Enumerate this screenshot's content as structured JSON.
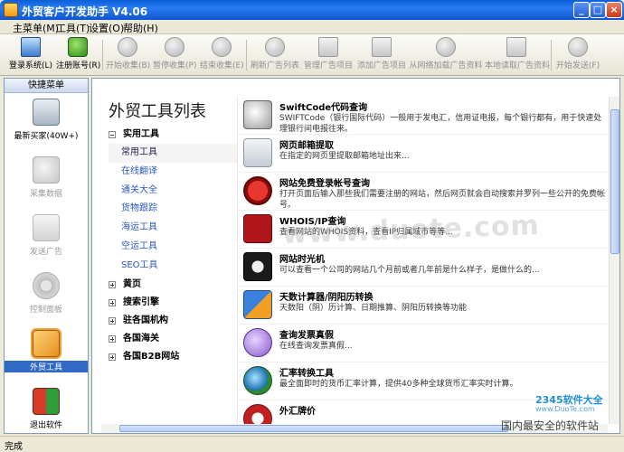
{
  "window": {
    "title": "外贸客户开发助手 V4.06"
  },
  "menu": [
    "主菜单(M)",
    "工具(T)",
    "设置(O)",
    "帮助(H)"
  ],
  "toolbar": [
    {
      "label": "登录系统(L)",
      "icon": "monitor-icon",
      "enabled": true
    },
    {
      "label": "注册账号(R)",
      "icon": "add-user-icon",
      "enabled": true
    },
    {
      "label": "开始收集(B)",
      "icon": "play-icon",
      "enabled": false
    },
    {
      "label": "暂停收集(P)",
      "icon": "pause-icon",
      "enabled": false
    },
    {
      "label": "结束收集(E)",
      "icon": "stop-icon",
      "enabled": false
    },
    {
      "label": "刷新广告列表",
      "icon": "refresh-icon",
      "enabled": false
    },
    {
      "label": "管理广告项目",
      "icon": "list-icon",
      "enabled": false
    },
    {
      "label": "添加广告项目",
      "icon": "add-doc-icon",
      "enabled": false
    },
    {
      "label": "从网络加载广告资料",
      "icon": "network-download-icon",
      "enabled": false
    },
    {
      "label": "本地读取广告资料",
      "icon": "open-book-icon",
      "enabled": false
    },
    {
      "label": "开始发送(F)",
      "icon": "send-icon",
      "enabled": false
    }
  ],
  "sidebar": {
    "header": "快捷菜单",
    "items": [
      {
        "label": "最新买家(40W+)",
        "icon": "shopping-cart-icon",
        "enabled": true
      },
      {
        "label": "采集数据",
        "icon": "magnifier-icon",
        "enabled": false
      },
      {
        "label": "发送广告",
        "icon": "mail-icon",
        "enabled": false
      },
      {
        "label": "控制面板",
        "icon": "gear-icon",
        "enabled": false
      },
      {
        "label": "外贸工具",
        "icon": "tools-icon",
        "enabled": true,
        "selected": true
      },
      {
        "label": "退出软件",
        "icon": "exit-icon",
        "enabled": true
      }
    ]
  },
  "main": {
    "heading": "外贸工具列表",
    "tree": {
      "categories": [
        {
          "label": "实用工具",
          "expanded": true,
          "children": [
            "常用工具",
            "在线翻译",
            "通关大全",
            "货物跟踪",
            "海运工具",
            "空运工具",
            "SEO工具"
          ]
        },
        {
          "label": "黄页",
          "expanded": false
        },
        {
          "label": "搜索引擎",
          "expanded": false
        },
        {
          "label": "驻各国机构",
          "expanded": false
        },
        {
          "label": "各国海关",
          "expanded": false
        },
        {
          "label": "各国B2B网站",
          "expanded": false
        }
      ]
    },
    "tools": [
      {
        "name": "SwiftCode代码查询",
        "desc": "SWIFTCode（银行国际代码）一般用于发电汇，信用证电报，每个银行都有，用于快速处理银行间电报往来。",
        "icon": "magnifier-icon",
        "color": "#8a8a8a"
      },
      {
        "name": "网页邮箱提取",
        "desc": "在指定的网页里提取邮箱地址出来...",
        "icon": "envelope-icon",
        "color": "#cfd6de"
      },
      {
        "name": "网站免费登录帐号查询",
        "desc": "打开页面后输入那些我们需要注册的网站，然后网页就会自动搜索并罗列一些公开的免费帐号。",
        "icon": "no-entry-icon",
        "color": "#c0181a"
      },
      {
        "name": "WHOIS/IP查询",
        "desc": "查看网站的WHOIS资料，查看IP归属域市等等...",
        "icon": "whois-icon",
        "color": "#b0151c"
      },
      {
        "name": "网站时光机",
        "desc": "可以查看一个公司的网站几个月前或者几年前是什么样子，是做什么的...",
        "icon": "archive-icon",
        "color": "#2a2a2a"
      },
      {
        "name": "天数计算器/阴阳历转换",
        "desc": "天数阳（阴）历计算、日期推算、阴阳历转换等功能",
        "icon": "calculator-icon",
        "color": "#2d6fd2"
      },
      {
        "name": "查询发票真假",
        "desc": "在线查询发票真假...",
        "icon": "invoice-magnifier-icon",
        "color": "#8a55c9"
      },
      {
        "name": "汇率转换工具",
        "desc": "最全面即时的货币汇率计算，提供40多种全球货币汇率实时计算。",
        "icon": "globe-icon",
        "color": "#2f8a33"
      },
      {
        "name": "外汇牌价",
        "desc": "",
        "icon": "forex-icon",
        "color": "#c02020"
      }
    ]
  },
  "watermark": "www.duote.com",
  "corner_logo": {
    "brand": "2345软件大全",
    "url": "www.DuoTe.com",
    "slogan": "国内最安全的软件站"
  },
  "statusbar": {
    "text": "完成"
  }
}
